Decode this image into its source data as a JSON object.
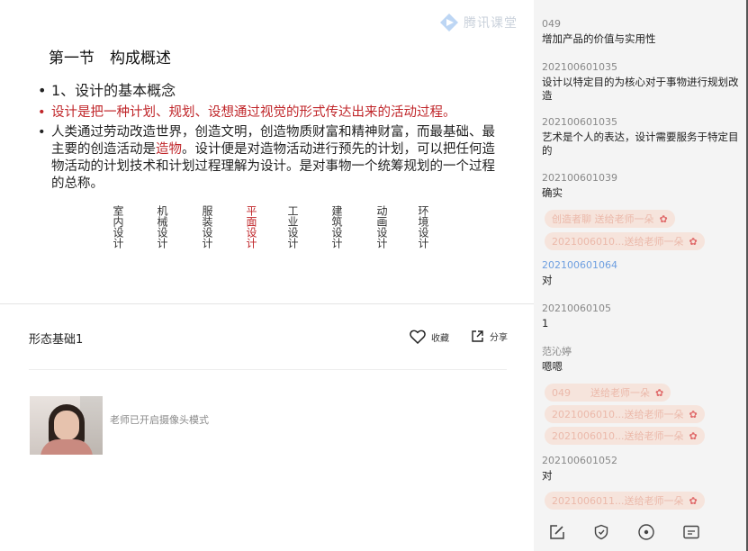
{
  "slide": {
    "logo_text": "腾讯课堂",
    "title": "第一节　构成概述",
    "bullets": {
      "b1": "1、设计的基本概念",
      "b2": "设计是把一种计划、规划、设想通过视觉的形式传达出来的活动过程。",
      "b3_pre": "人类通过劳动改造世界，创造文明，创造物质财富和精神财富，而最基础、最主要的创造活动是",
      "b3_hl": "造物",
      "b3_post": "。设计便是对造物活动进行预先的计划，可以把任何造物活动的计划技术和计划过程理解为设计。是对事物一个统筹规划的一个过程的总称。"
    },
    "categories": [
      "室内设计",
      "机械设计",
      "服装设计",
      "平面设计",
      "工业设计",
      "建筑设计",
      "动画设计",
      "环境设计"
    ],
    "active_category": "平面设计"
  },
  "course": {
    "title": "形态基础1",
    "favorite_label": "收藏",
    "share_label": "分享"
  },
  "camera": {
    "note": "老师已开启摄像头模式"
  },
  "chat": {
    "messages": [
      {
        "name": "049",
        "text": "增加产品的价值与实用性"
      },
      {
        "name": "202100601035",
        "text": "设计以特定目的为核心对于事物进行规划改造"
      },
      {
        "name": "202100601035",
        "text": "艺术是个人的表达，设计需要服务于特定目的"
      },
      {
        "name": "202100601039",
        "text": "确实"
      },
      {
        "name": "202100601064",
        "text": "对"
      },
      {
        "name": "20210060105",
        "text": "1"
      },
      {
        "name": "范沁婷",
        "text": "嗯嗯"
      },
      {
        "name": "202100601052",
        "text": "对"
      }
    ],
    "gifts": [
      "创造者聊 送给老师一朵",
      "2021006010...送给老师一朵",
      "049　　送给老师一朵",
      "2021006010...送给老师一朵",
      "2021006010...送给老师一朵",
      "2021006011...送给老师一朵"
    ]
  },
  "toolbar": {
    "icons": [
      "edit-icon",
      "shield-icon",
      "target-icon",
      "card-icon"
    ]
  }
}
